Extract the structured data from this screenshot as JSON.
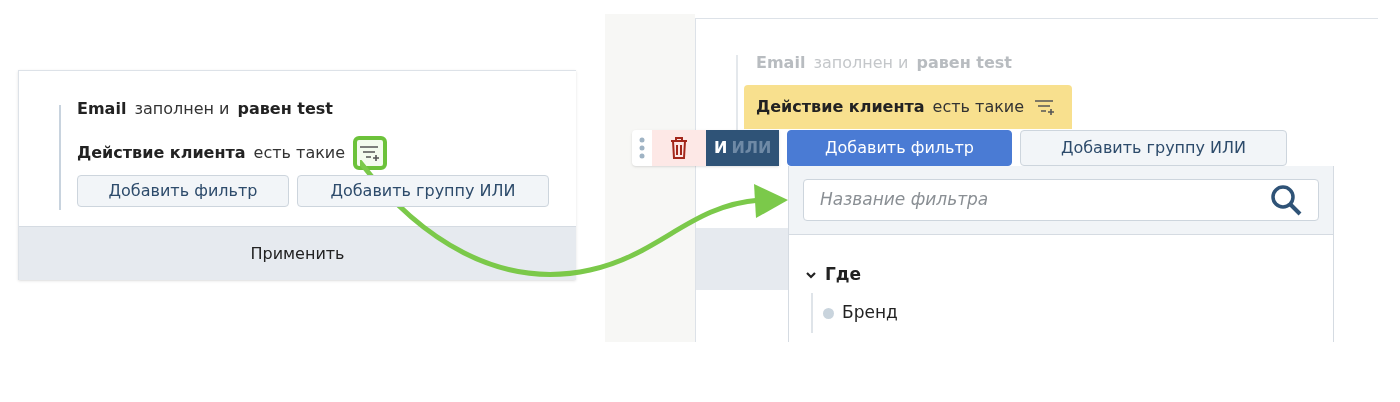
{
  "left_panel": {
    "conditions": [
      {
        "field": "Email",
        "operator": "заполнен и",
        "value": "равен test",
        "dimmed": false,
        "selected": false
      },
      {
        "field": "Действие клиента",
        "operator": "есть такие",
        "dimmed": false,
        "selected": false,
        "icon": {
          "highlighted": true
        }
      }
    ],
    "buttons": [
      {
        "label": "Добавить фильтр",
        "primary": false
      },
      {
        "label": "Добавить группу ИЛИ",
        "primary": false
      }
    ],
    "apply_button": "Применить"
  },
  "right_panel": {
    "conditions": [
      {
        "field": "Email",
        "operator": "заполнен и",
        "value": "равен test",
        "dimmed": true,
        "selected": false
      },
      {
        "field": "Действие клиента",
        "operator": "есть такие",
        "dimmed": false,
        "selected": true,
        "icon": {
          "highlighted": false
        }
      }
    ],
    "logic": [
      {
        "label": "И",
        "selected": true
      },
      {
        "label": "ИЛИ",
        "selected": false
      }
    ],
    "buttons": [
      {
        "label": "Добавить фильтр",
        "primary": true
      },
      {
        "label": "Добавить группу ИЛИ",
        "primary": false
      }
    ],
    "dropdown": {
      "search": {
        "placeholder": "Название фильтра"
      },
      "tree": [
        {
          "label": "Где",
          "expanded": true,
          "children": [
            {
              "label": "Бренд"
            }
          ]
        }
      ]
    }
  }
}
